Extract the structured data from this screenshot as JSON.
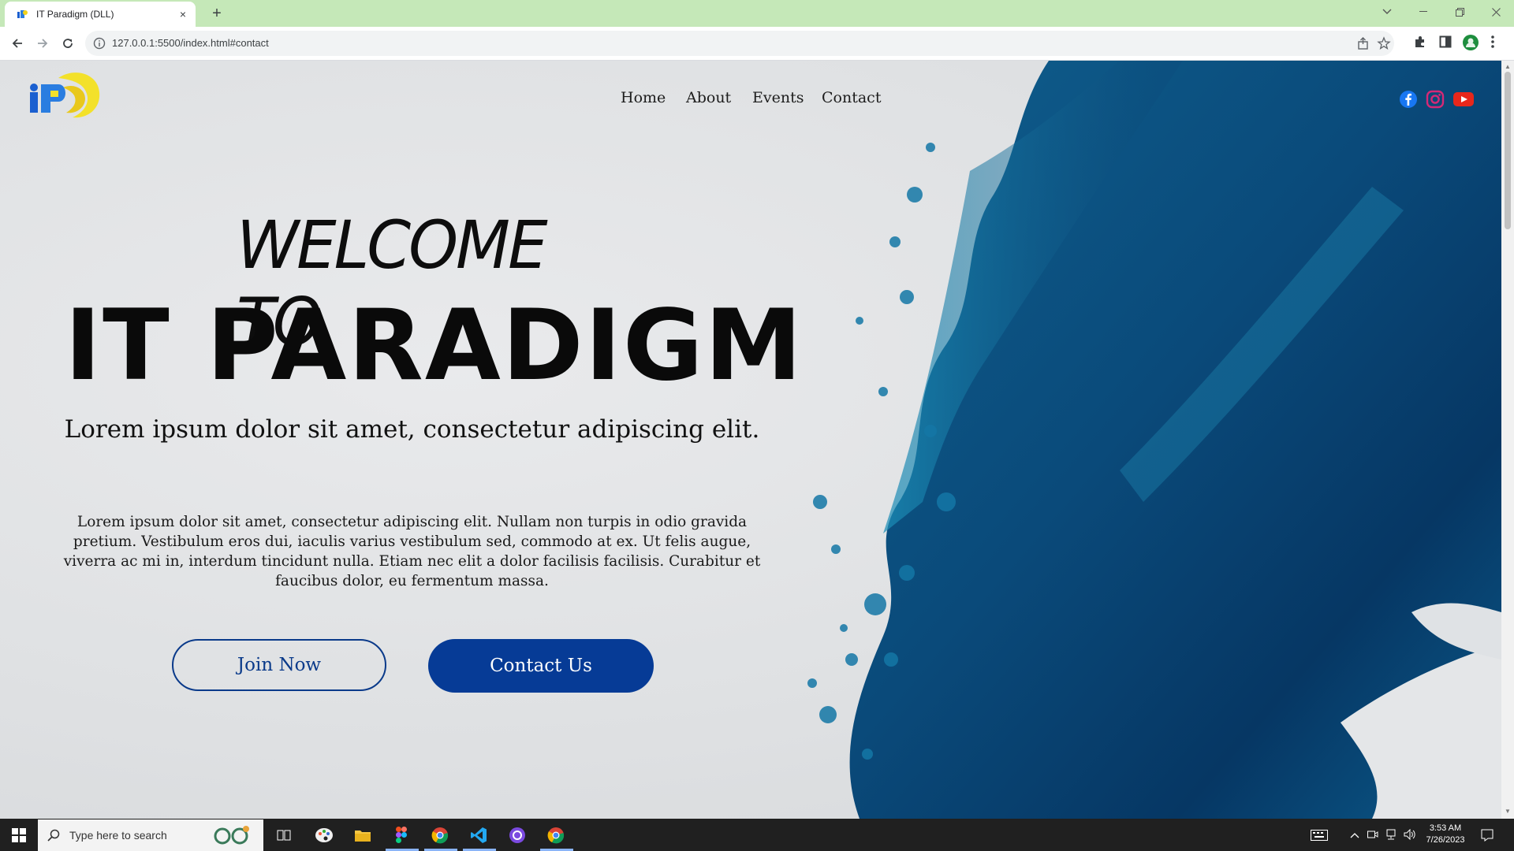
{
  "browser": {
    "tab_title": "IT Paradigm (DLL)",
    "tab_close": "×",
    "new_tab": "+",
    "url": "127.0.0.1:5500/index.html#contact"
  },
  "site": {
    "logo_text": "iP",
    "nav": [
      "Home",
      "About",
      "Events",
      "Contact"
    ],
    "social_icons": [
      "facebook-icon",
      "instagram-icon",
      "youtube-icon"
    ],
    "welcome": "WELCOME TO",
    "title": "IT PARADIGM",
    "subtitle": "Lorem ipsum dolor sit amet, consectetur adipiscing elit.",
    "paragraph": "Lorem ipsum dolor sit amet, consectetur adipiscing elit. Nullam non turpis in odio gravida pretium. Vestibulum eros dui, iaculis varius vestibulum sed, commodo at ex. Ut felis augue, viverra ac mi in, interdum tincidunt nulla. Etiam nec elit a dolor facilisis facilisis. Curabitur et faucibus dolor, eu fermentum massa.",
    "join_button": "Join Now",
    "contact_button": "Contact Us"
  },
  "taskbar": {
    "search_placeholder": "Type here to search",
    "time": "3:53 AM",
    "date": "7/26/2023"
  },
  "colors": {
    "tabstrip": "#c5e8b8",
    "brand_blue": "#063b96",
    "paint_blue": "#0a5a8c",
    "youtube_red": "#e8271b",
    "instagram_pink": "#d62976",
    "facebook_blue": "#1877f2"
  }
}
